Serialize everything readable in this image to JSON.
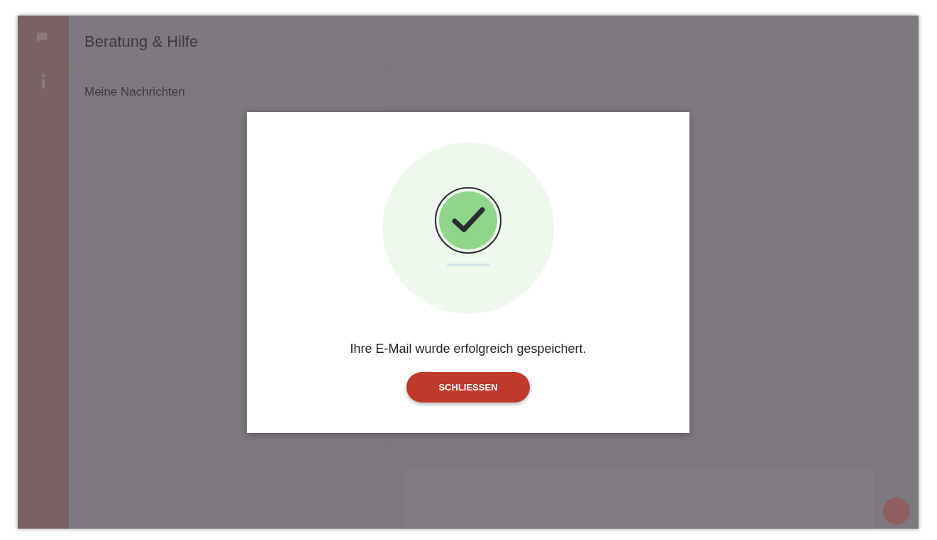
{
  "app": {
    "title": "Beratung & Hilfe",
    "section_title": "Meine Nachrichten"
  },
  "dialog": {
    "message": "Ihre E-Mail wurde erfolgreich gespeichert.",
    "button": "SCHLIESSEN",
    "success": true
  }
}
